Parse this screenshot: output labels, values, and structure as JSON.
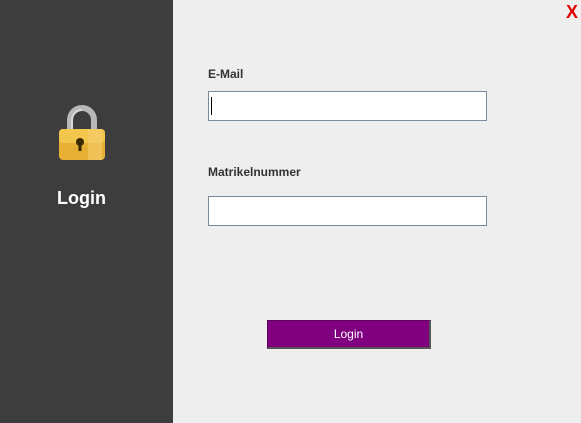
{
  "sidebar": {
    "icon": "lock-icon",
    "title": "Login"
  },
  "window": {
    "close_label": "X",
    "close_color": "#e00000"
  },
  "form": {
    "email": {
      "label": "E-Mail",
      "value": "",
      "placeholder": ""
    },
    "matrikel": {
      "label": "Matrikelnummer",
      "value": "",
      "placeholder": ""
    },
    "submit_label": "Login",
    "submit_color": "#800080"
  }
}
